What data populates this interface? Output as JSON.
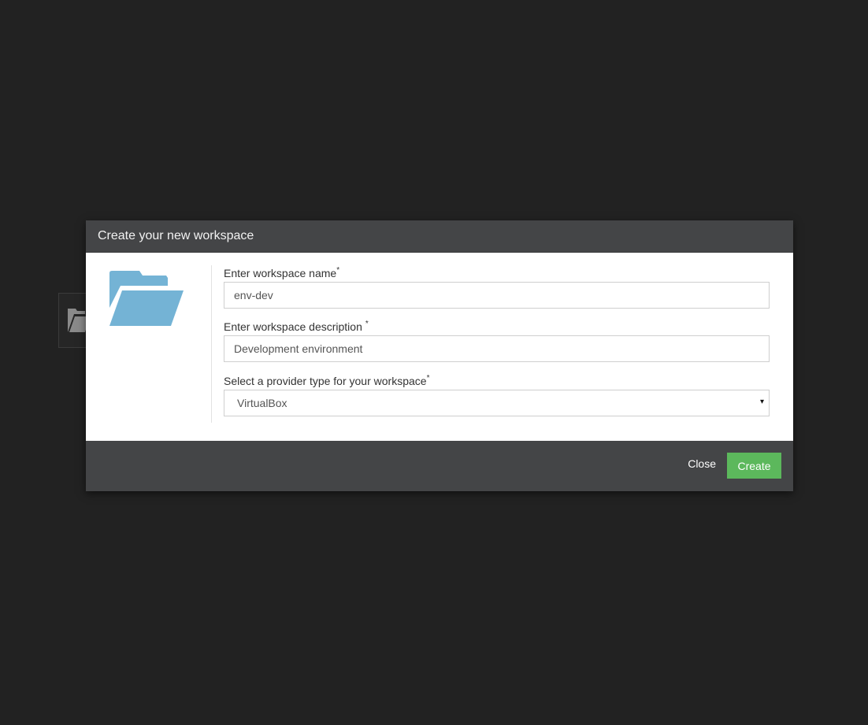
{
  "modal": {
    "title": "Create your new workspace",
    "icon": "folder-open-icon"
  },
  "form": {
    "name": {
      "label": "Enter workspace name",
      "required_mark": "*",
      "value": "env-dev"
    },
    "description": {
      "label": "Enter workspace description",
      "required_mark": "*",
      "value": "Development environment"
    },
    "provider": {
      "label": "Select a provider type for your workspace",
      "required_mark": "*",
      "selected": "VirtualBox",
      "arrow": "▾"
    }
  },
  "footer": {
    "close_label": "Close",
    "create_label": "Create"
  },
  "colors": {
    "background": "#222222",
    "header_footer": "#444547",
    "folder_icon": "#74b3d5",
    "create_button": "#5cb85c"
  }
}
